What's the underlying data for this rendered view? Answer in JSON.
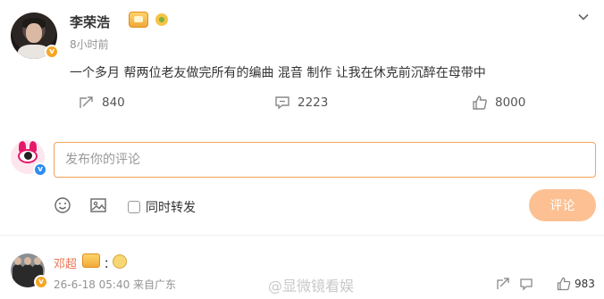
{
  "post": {
    "author": "李荣浩",
    "time_ago": "8小时前",
    "text": "一个多月 帮两位老友做完所有的编曲 混音 制作 让我在休克前沉醉在母带中",
    "badges": [
      "crown-badge",
      "flower-badge"
    ]
  },
  "actions": {
    "forward_count": "840",
    "comment_count": "2223",
    "like_count": "8000"
  },
  "composer": {
    "placeholder": "发布你的评论",
    "repost_label": "同时转发",
    "submit_label": "评论"
  },
  "comments": [
    {
      "author": "邓超",
      "colon": "：",
      "meta": "26-6-18 05:40 来自广东",
      "like_count": "983"
    }
  ],
  "watermark": "@显微镜看娱",
  "colors": {
    "accent": "#ff8200",
    "submit_bg": "#fcc092",
    "input_border": "#f5a25a",
    "author_link": "#eb7350",
    "muted": "#939393"
  }
}
